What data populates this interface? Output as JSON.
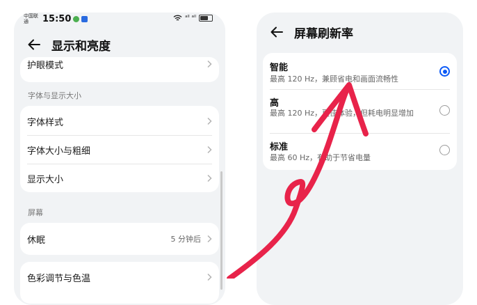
{
  "left": {
    "status": {
      "carrier": "中国联通",
      "time": "15:50",
      "signal": "ᵃˡˡ ᵃˡˡ"
    },
    "title": "显示和亮度",
    "partial_row": "护眼模式",
    "section_font": "字体与显示大小",
    "font_rows": [
      "字体样式",
      "字体大小与粗细",
      "显示大小"
    ],
    "section_screen": "屏幕",
    "sleep": {
      "label": "休眠",
      "value": "5 分钟后"
    },
    "bottom_row": "色彩调节与色温"
  },
  "right": {
    "title": "屏幕刷新率",
    "options": [
      {
        "title": "智能",
        "desc": "最高 120 Hz，兼顾省电和画面流畅性",
        "selected": true
      },
      {
        "title": "高",
        "desc": "最高 120 Hz，更佳体验，但耗电明显增加",
        "selected": false
      },
      {
        "title": "标准",
        "desc": "最高 60 Hz，有助于节省电量",
        "selected": false
      }
    ]
  },
  "colors": {
    "accent": "#0a59f7",
    "annotation_arrow": "#e8234a",
    "card": "#ffffff",
    "background": "#f1f3f5"
  },
  "icons": [
    "back-arrow-icon",
    "chevron-right-icon",
    "radio-icon",
    "wifi-icon",
    "battery-icon"
  ]
}
